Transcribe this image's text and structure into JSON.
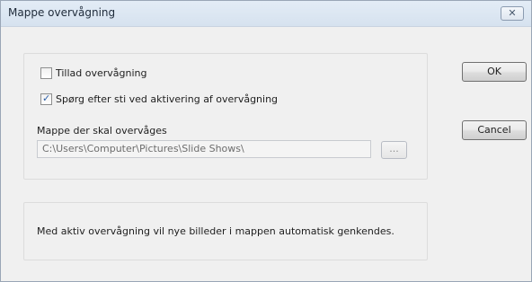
{
  "window": {
    "title": "Mappe overvågning",
    "close_glyph": "✕"
  },
  "monitoring": {
    "allow_label": "Tillad overvågning",
    "allow_checked": false,
    "ask_label": "Spørg efter sti ved aktivering af overvågning",
    "ask_checked": true,
    "folder_label": "Mappe der skal overvåges",
    "folder_path": "C:\\Users\\Computer\\Pictures\\Slide Shows\\",
    "browse_label": "..."
  },
  "info": {
    "text": "Med aktiv overvågning vil nye billeder i mappen automatisk genkendes."
  },
  "buttons": {
    "ok_label": "OK",
    "cancel_label": "Cancel"
  },
  "icons": {
    "checkbox_checked": "check-icon",
    "close": "close-icon"
  }
}
